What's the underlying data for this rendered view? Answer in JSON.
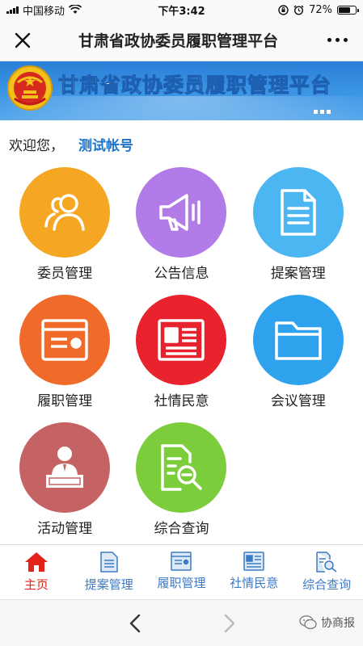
{
  "status_bar": {
    "carrier": "中国移动",
    "time": "下午3:42",
    "battery_percent": "72%",
    "battery_level": 0.72
  },
  "nav": {
    "title": "甘肃省政协委员履职管理平台",
    "close_icon": "close-icon",
    "more_icon": "more-icon"
  },
  "banner": {
    "text": "甘肃省政协委员履职管理平台"
  },
  "welcome": {
    "greeting": "欢迎您，",
    "account": "测试帐号"
  },
  "modules": [
    {
      "label": "委员管理",
      "icon": "people-icon",
      "color": "#f5a623"
    },
    {
      "label": "公告信息",
      "icon": "megaphone-icon",
      "color": "#b27ce8"
    },
    {
      "label": "提案管理",
      "icon": "document-icon",
      "color": "#4cb6f2"
    },
    {
      "label": "履职管理",
      "icon": "browser-window-icon",
      "color": "#f06a2a"
    },
    {
      "label": "社情民意",
      "icon": "newspaper-icon",
      "color": "#e8232e"
    },
    {
      "label": "会议管理",
      "icon": "folder-icon",
      "color": "#2fa2ee"
    },
    {
      "label": "活动管理",
      "icon": "presenter-icon",
      "color": "#c56263"
    },
    {
      "label": "综合查询",
      "icon": "search-document-icon",
      "color": "#7ccd3c"
    }
  ],
  "tabs": [
    {
      "label": "主页",
      "icon": "home-icon",
      "active": true
    },
    {
      "label": "提案管理",
      "icon": "document-icon",
      "active": false
    },
    {
      "label": "履职管理",
      "icon": "browser-window-icon",
      "active": false
    },
    {
      "label": "社情民意",
      "icon": "newspaper-icon",
      "active": false
    },
    {
      "label": "综合查询",
      "icon": "search-document-icon",
      "active": false
    }
  ],
  "watermark": "协商报",
  "colors": {
    "accent_blue": "#1e74c8",
    "tab_blue": "#3d7ac4",
    "tab_active_red": "#e2231a",
    "banner_blue": "#3e97e6"
  }
}
